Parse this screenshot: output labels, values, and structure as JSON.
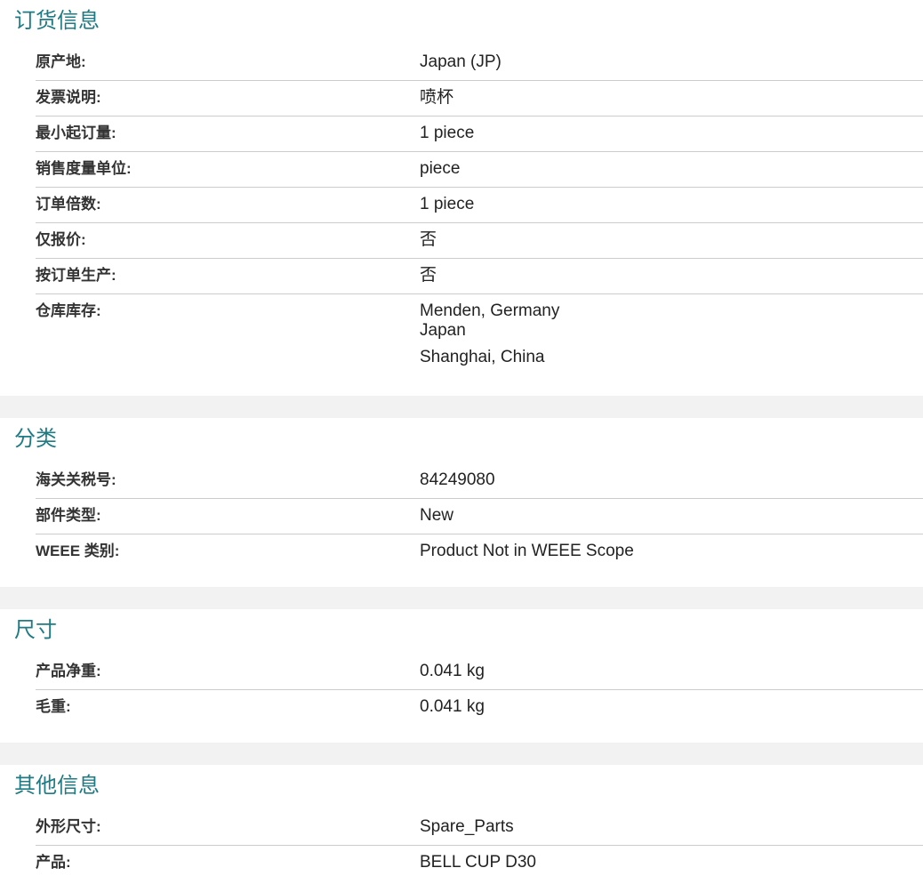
{
  "sections": [
    {
      "title": "订货信息",
      "rows": [
        {
          "label": "原产地:",
          "value": "Japan (JP)"
        },
        {
          "label": "发票说明:",
          "value": "喷杯"
        },
        {
          "label": "最小起订量:",
          "value": "1 piece"
        },
        {
          "label": "销售度量单位:",
          "value": "piece"
        },
        {
          "label": "订单倍数:",
          "value": "1 piece"
        },
        {
          "label": "仅报价:",
          "value": "否"
        },
        {
          "label": "按订单生产:",
          "value": "否"
        },
        {
          "label": "仓库库存:",
          "values": [
            "Menden, Germany",
            "Japan",
            "Shanghai, China"
          ]
        }
      ]
    },
    {
      "title": "分类",
      "rows": [
        {
          "label": "海关关税号:",
          "value": "84249080"
        },
        {
          "label": "部件类型:",
          "value": "New"
        },
        {
          "label": "WEEE 类别:",
          "value": "Product Not in WEEE Scope"
        }
      ]
    },
    {
      "title": "尺寸",
      "rows": [
        {
          "label": "产品净重:",
          "value": "0.041 kg"
        },
        {
          "label": "毛重:",
          "value": "0.041 kg"
        }
      ]
    },
    {
      "title": "其他信息",
      "rows": [
        {
          "label": "外形尺寸:",
          "value": "Spare_Parts"
        },
        {
          "label": "产品:",
          "value": "BELL CUP D30"
        }
      ]
    }
  ]
}
